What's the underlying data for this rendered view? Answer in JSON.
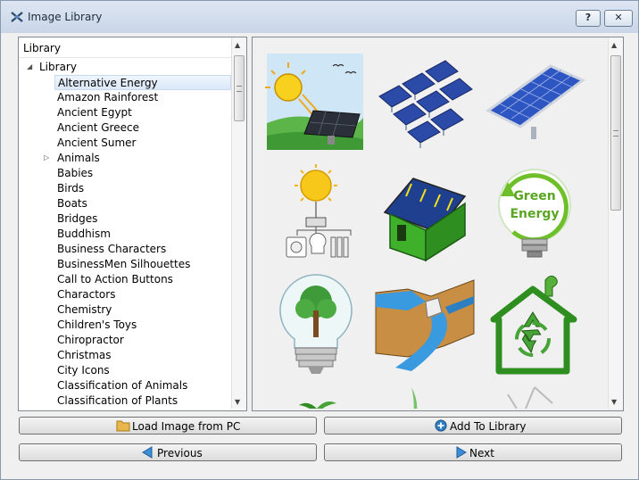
{
  "window": {
    "title": "Image Library",
    "help_label": "?",
    "close_label": "✕"
  },
  "tree": {
    "header": "Library",
    "root_label": "Library",
    "items": [
      "Alternative Energy",
      "Amazon Rainforest",
      "Ancient Egypt",
      "Ancient Greece",
      "Ancient Sumer",
      "Animals",
      "Babies",
      "Birds",
      "Boats",
      "Bridges",
      "Buddhism",
      "Business Characters",
      "BusinessMen Silhouettes",
      "Call to Action Buttons",
      "Charactors",
      "Chemistry",
      "Children's Toys",
      "Chiropractor",
      "Christmas",
      "City Icons",
      "Classification of Animals",
      "Classification of Plants"
    ],
    "selected_index": 0,
    "expandable_index": 5,
    "scroll_position": 0.0
  },
  "thumbnails": [
    "sun-solar-panel",
    "solar-panel-array",
    "solar-panel-single",
    "sun-power-outlet",
    "green-house-solar-roof",
    "green-energy-bulb",
    "tree-light-bulb",
    "hydro-dam",
    "eco-house-recycle"
  ],
  "buttons": {
    "load": "Load Image from PC",
    "add": "Add To Library",
    "previous": "Previous",
    "next": "Next"
  },
  "icons": {
    "load": "folder-icon",
    "add": "plus-circle-icon",
    "previous": "arrow-left-icon",
    "next": "arrow-right-icon"
  },
  "colors": {
    "accent": "#3a8fd6",
    "selection": "#dbe8f7",
    "green": "#3aa12a"
  }
}
